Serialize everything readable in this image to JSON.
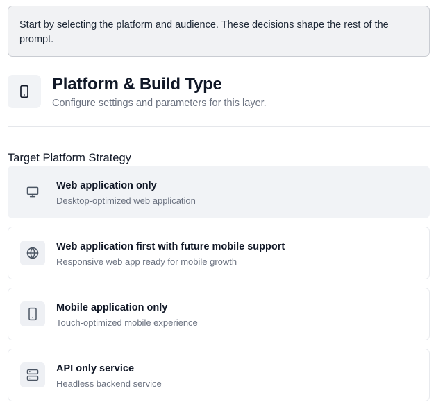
{
  "notice": {
    "text": "Start by selecting the platform and audience. These decisions shape the rest of the prompt."
  },
  "header": {
    "icon": "smartphone-icon",
    "title": "Platform & Build Type",
    "subtitle": "Configure settings and parameters for this layer."
  },
  "section": {
    "label": "Target Platform Strategy"
  },
  "options": [
    {
      "icon": "monitor-icon",
      "title": "Web application only",
      "description": "Desktop-optimized web application",
      "selected": true
    },
    {
      "icon": "globe-icon",
      "title": "Web application first with future mobile support",
      "description": "Responsive web app ready for mobile growth",
      "selected": false
    },
    {
      "icon": "smartphone-icon",
      "title": "Mobile application only",
      "description": "Touch-optimized mobile experience",
      "selected": false
    },
    {
      "icon": "server-icon",
      "title": "API only service",
      "description": "Headless backend service",
      "selected": false
    }
  ],
  "colors": {
    "text_primary": "#111827",
    "text_secondary": "#6b7280",
    "selected_bg": "#f1f3f6",
    "border": "#e8eaee"
  }
}
